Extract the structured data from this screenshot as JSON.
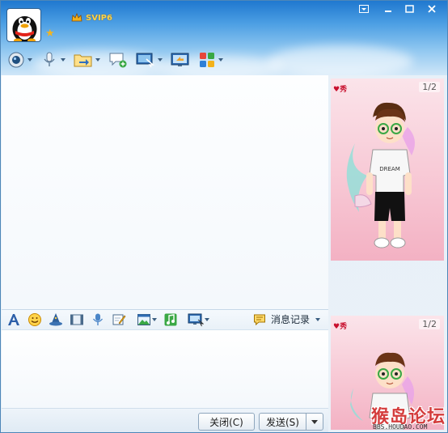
{
  "header": {
    "vip_label": "SVIP6"
  },
  "window_controls": [
    "menu",
    "minimize",
    "maximize",
    "close"
  ],
  "toolbar": {
    "items": [
      {
        "icon": "video-call-icon"
      },
      {
        "icon": "voice-call-icon"
      },
      {
        "icon": "send-file-icon"
      },
      {
        "icon": "create-discussion-icon"
      },
      {
        "icon": "remote-assist-icon"
      },
      {
        "icon": "share-screen-icon"
      },
      {
        "icon": "apps-icon"
      }
    ]
  },
  "input_toolbar": {
    "history_label": "消息记录"
  },
  "buttons": {
    "close_label": "关闭(C)",
    "send_label": "发送(S)"
  },
  "show_panel": {
    "badge": "♥秀",
    "page_counter": "1/2",
    "shirt_text": "DREAM"
  },
  "watermark": {
    "text": "猴岛论坛",
    "url": "BBS.HOUDAO.COM"
  },
  "colors": {
    "title_blue": "#1f78cf",
    "accent_gold": "#ffd64a",
    "panel_pink": "#f7c6d3"
  }
}
